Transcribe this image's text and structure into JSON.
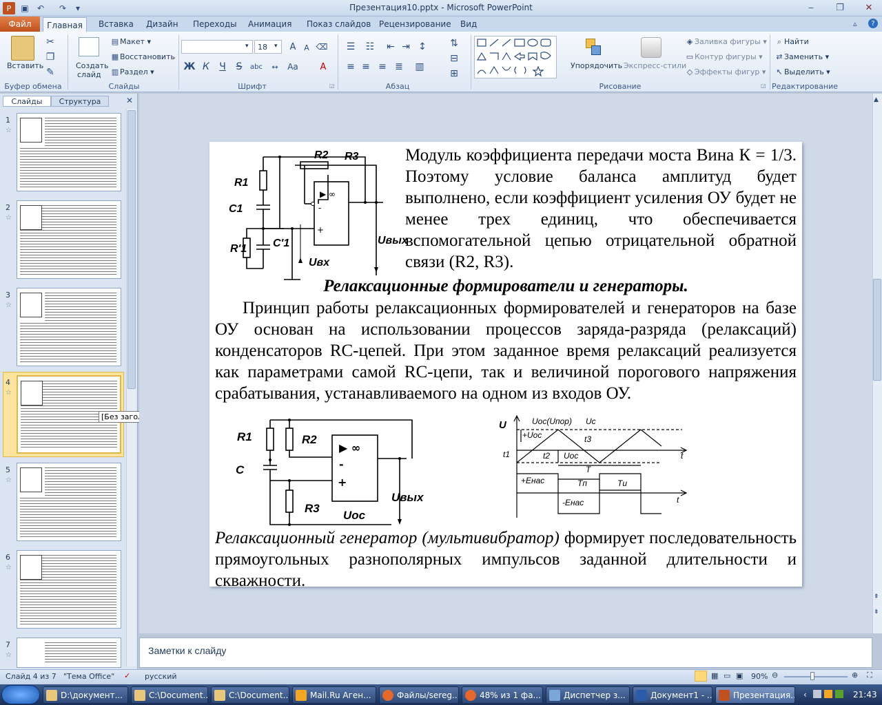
{
  "window": {
    "title": "Презентация10.pptx - Microsoft PowerPoint"
  },
  "tabs": {
    "file": "Файл",
    "home": "Главная",
    "items": [
      "Вставка",
      "Дизайн",
      "Переходы",
      "Анимация",
      "Показ слайдов",
      "Рецензирование",
      "Вид"
    ]
  },
  "ribbon": {
    "clipboard": {
      "paste": "Вставить",
      "label": "Буфер обмена"
    },
    "slides": {
      "new_slide_line1": "Создать",
      "new_slide_line2": "слайд",
      "layout": "Макет",
      "reset": "Восстановить",
      "section": "Раздел",
      "label": "Слайды"
    },
    "font": {
      "size": "18",
      "bold": "Ж",
      "italic": "К",
      "underline": "Ч",
      "strike": "S",
      "shadow": "abc",
      "label": "Шрифт"
    },
    "paragraph": {
      "label": "Абзац"
    },
    "drawing": {
      "arrange": "Упорядочить",
      "quick_styles": "Экспресс-стили",
      "fill": "Заливка фигуры",
      "outline": "Контур фигуры",
      "effects": "Эффекты фигур",
      "label": "Рисование"
    },
    "editing": {
      "find": "Найти",
      "replace": "Заменить",
      "select": "Выделить",
      "label": "Редактирование"
    }
  },
  "left_pane": {
    "tab_slides": "Слайды",
    "tab_outline": "Структура",
    "slide_numbers": [
      "1",
      "2",
      "3",
      "4",
      "5",
      "6",
      "7"
    ],
    "tooltip": "[Без заголовка]"
  },
  "slide": {
    "para1": "Модуль коэффициента передачи моста Вина К = 1/3. Поэтому условие баланса амплитуд будет выполнено, если коэффициент усиления ОУ будет не менее трех единиц, что обеспечивается вспомогательной цепью отрицательной обратной связи (R2, R3).",
    "heading": "Релаксационные формирователи и генераторы.",
    "para2": "Принцип работы релаксационных формирователей и генераторов на базе ОУ основан на использовании процессов заряда-разряда (релаксаций) конденсаторов RC-цепей. При этом заданное время релаксаций реализуется как параметрами самой RC-цепи, так и величиной порогового напряжения срабатывания, устанавливаемого на одном из входов ОУ.",
    "para3_italic": "Релаксационный генератор (мультивибратор)",
    "para3_rest": " формирует последовательность прямоугольных разнополярных импульсов заданной длительности и скважности.",
    "c1": {
      "R1": "R1",
      "R2": "R2",
      "R3": "R3",
      "C1": "C1",
      "R1p": "R'1",
      "C1p": "C'1",
      "Uvx": "Uвх",
      "Uvyx": "Uвых",
      "inf": "▶ ∞",
      "minus": "-",
      "plus": "+"
    },
    "c2": {
      "R1": "R1",
      "R2": "R2",
      "R3": "R3",
      "C": "C",
      "Uoc": "Uос",
      "Uvyx": "Uвых",
      "inf": "▶ ∞",
      "minus": "-",
      "plus": "+"
    },
    "graph": {
      "U": "U",
      "Uoc_por": "Uос(Uпор)",
      "Uc": "Uc",
      "plusUoc": "+Uос",
      "Uoc": "Uос",
      "t1": "t1",
      "t2": "t2",
      "t3": "t3",
      "t": "t",
      "T": "T",
      "Tp": "Tп",
      "Ti": "Tи",
      "plusEnas": "+Eнас",
      "minusEnas": "-Eнас"
    }
  },
  "notes": "Заметки к слайду",
  "status": {
    "slide": "Слайд 4 из 7",
    "theme": "\"Тема Office\"",
    "lang": "русский",
    "zoom": "90%"
  },
  "taskbar": {
    "items": [
      "D:\\документ...",
      "C:\\Document...",
      "C:\\Document...",
      "Mail.Ru Аген...",
      "Файлы/sereg...",
      "48% из 1 фа...",
      "Диспетчер з...",
      "Документ1 - ...",
      "Презентация..."
    ],
    "time": "21:43"
  }
}
